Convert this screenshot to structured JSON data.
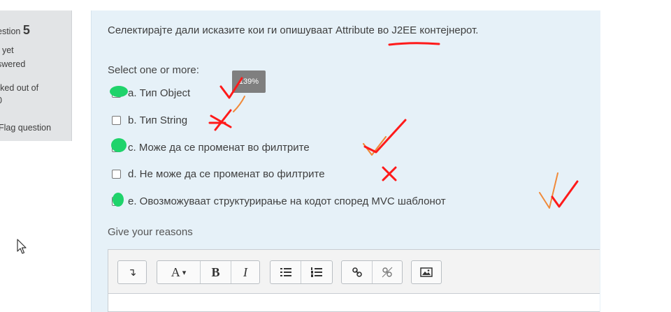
{
  "info": {
    "question_prefix": "estion",
    "question_number": "5",
    "status_line1": "t yet",
    "status_line2": "swered",
    "marked_line1": "rked out of",
    "marked_line2": "0",
    "flag_label": "Flag question"
  },
  "question": {
    "text": "Селектирајте дали исказите кои ги опишуваат Attribute во J2EE контејнерот.",
    "prompt": "Select one or more:",
    "options": [
      {
        "label": "a. Тип Object",
        "selected": true
      },
      {
        "label": "b. Тип String",
        "selected": false
      },
      {
        "label": "c. Може да се променат во филтрите",
        "selected": true
      },
      {
        "label": "d. Не може да се променат во филтрите",
        "selected": false
      },
      {
        "label": "e. Овозможуваат структурирање на кодот според MVC шаблонот",
        "selected": true
      }
    ]
  },
  "tooltip": "139%",
  "reasons": {
    "label": "Give your reasons",
    "toolbar": {
      "undo": "↴",
      "font": "A",
      "font_caret": "▾",
      "bold": "B",
      "italic": "I"
    }
  },
  "colors": {
    "panel_bg": "#e6f1f8",
    "info_bg": "#e2e4e6",
    "highlight_green": "#1fd36b",
    "mark_red": "#ff1a1a",
    "mark_orange": "#f08a3a"
  }
}
